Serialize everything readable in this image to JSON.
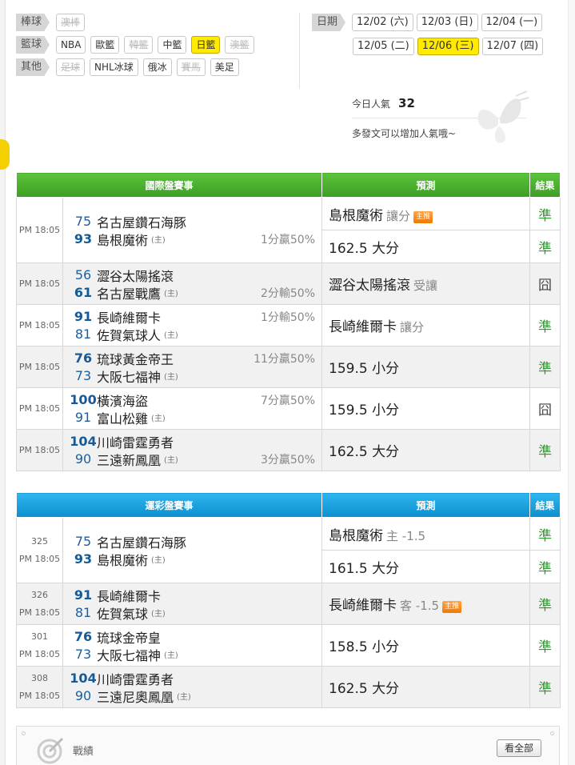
{
  "filters": [
    {
      "label": "棒球",
      "chips": [
        {
          "text": "澳棒",
          "state": "disabled"
        }
      ]
    },
    {
      "label": "籃球",
      "chips": [
        {
          "text": "NBA",
          "state": "normal"
        },
        {
          "text": "歐籃",
          "state": "normal"
        },
        {
          "text": "韓籃",
          "state": "disabled"
        },
        {
          "text": "中籃",
          "state": "normal"
        },
        {
          "text": "日籃",
          "state": "selected"
        },
        {
          "text": "澳籃",
          "state": "disabled"
        }
      ]
    },
    {
      "label": "其他",
      "chips": [
        {
          "text": "足球",
          "state": "disabled"
        },
        {
          "text": "NHL冰球",
          "state": "normal"
        },
        {
          "text": "俄冰",
          "state": "normal"
        },
        {
          "text": "賽馬",
          "state": "disabled"
        },
        {
          "text": "美足",
          "state": "normal"
        }
      ]
    }
  ],
  "dates": {
    "label": "日期",
    "rows": [
      [
        {
          "text": "12/02 (六)",
          "selected": false
        },
        {
          "text": "12/03 (日)",
          "selected": false
        },
        {
          "text": "12/04 (一)",
          "selected": false
        }
      ],
      [
        {
          "text": "12/05 (二)",
          "selected": false
        },
        {
          "text": "12/06 (三)",
          "selected": true
        },
        {
          "text": "12/07 (四)",
          "selected": false
        }
      ]
    ]
  },
  "popularity": {
    "label": "今日人氣",
    "value": "32",
    "hint": "多發文可以增加人氣哦~"
  },
  "international": {
    "headers": [
      "國際盤賽事",
      "預測",
      "結果"
    ],
    "home_mark": "(主)",
    "games": [
      {
        "time": "PM 18:05",
        "away": {
          "score": "75",
          "name": "名古屋鑽石海豚"
        },
        "home": {
          "score": "93",
          "name": "島根魔術"
        },
        "odds": "1分贏50%",
        "odds_line": 2,
        "picks": [
          {
            "text": "島根魔術",
            "sub": "讓分",
            "tag": "主推",
            "result": "準"
          },
          {
            "text": "162.5 大分",
            "sub": "",
            "tag": "",
            "result": "準"
          }
        ]
      },
      {
        "time": "PM 18:05",
        "away": {
          "score": "56",
          "name": "澀谷太陽搖滾"
        },
        "home": {
          "score": "61",
          "name": "名古屋戰鷹"
        },
        "odds": "2分輸50%",
        "odds_line": 2,
        "picks": [
          {
            "text": "澀谷太陽搖滾",
            "sub": "受讓",
            "tag": "",
            "result": "囧"
          }
        ]
      },
      {
        "time": "PM 18:05",
        "away": {
          "score": "91",
          "name": "長崎維爾卡"
        },
        "home": {
          "score": "81",
          "name": "佐賀氣球人"
        },
        "odds": "1分輸50%",
        "odds_line": 1,
        "picks": [
          {
            "text": "長崎維爾卡",
            "sub": "讓分",
            "tag": "",
            "result": "準"
          }
        ]
      },
      {
        "time": "PM 18:05",
        "away": {
          "score": "76",
          "name": "琉球黃金帝王"
        },
        "home": {
          "score": "73",
          "name": "大阪七福神"
        },
        "odds": "11分贏50%",
        "odds_line": 1,
        "picks": [
          {
            "text": "159.5 小分",
            "sub": "",
            "tag": "",
            "result": "準"
          }
        ]
      },
      {
        "time": "PM 18:05",
        "away": {
          "score": "100",
          "name": "橫濱海盜"
        },
        "home": {
          "score": "91",
          "name": "富山松雞"
        },
        "odds": "7分贏50%",
        "odds_line": 1,
        "picks": [
          {
            "text": "159.5 小分",
            "sub": "",
            "tag": "",
            "result": "囧"
          }
        ]
      },
      {
        "time": "PM 18:05",
        "away": {
          "score": "104",
          "name": "川崎雷霆勇者"
        },
        "home": {
          "score": "90",
          "name": "三遠新鳳凰"
        },
        "odds": "3分贏50%",
        "odds_line": 2,
        "picks": [
          {
            "text": "162.5 大分",
            "sub": "",
            "tag": "",
            "result": "準"
          }
        ]
      }
    ]
  },
  "sportslottery": {
    "headers": [
      "運彩盤賽事",
      "預測",
      "結果"
    ],
    "home_mark": "(主)",
    "games": [
      {
        "num": "325",
        "time": "PM 18:05",
        "away": {
          "score": "75",
          "name": "名古屋鑽石海豚"
        },
        "home": {
          "score": "93",
          "name": "島根魔術"
        },
        "picks": [
          {
            "text": "島根魔術",
            "sub": "主 -1.5",
            "tag": "",
            "result": "準"
          },
          {
            "text": "161.5 大分",
            "sub": "",
            "tag": "",
            "result": "準"
          }
        ]
      },
      {
        "num": "326",
        "time": "PM 18:05",
        "away": {
          "score": "91",
          "name": "長崎維爾卡"
        },
        "home": {
          "score": "81",
          "name": "佐賀氣球"
        },
        "picks": [
          {
            "text": "長崎維爾卡",
            "sub": "客 -1.5",
            "tag": "主推",
            "result": "準"
          }
        ]
      },
      {
        "num": "301",
        "time": "PM 18:05",
        "away": {
          "score": "76",
          "name": "琉球金帝皇"
        },
        "home": {
          "score": "73",
          "name": "大阪七福神"
        },
        "picks": [
          {
            "text": "158.5 小分",
            "sub": "",
            "tag": "",
            "result": "準"
          }
        ]
      },
      {
        "num": "308",
        "time": "PM 18:05",
        "away": {
          "score": "104",
          "name": "川崎雷霆勇者"
        },
        "home": {
          "score": "90",
          "name": "三遠尼奧鳳凰"
        },
        "picks": [
          {
            "text": "162.5 大分",
            "sub": "",
            "tag": "",
            "result": "準"
          }
        ]
      }
    ]
  },
  "record": {
    "label": "戰績",
    "view_all": "看全部"
  }
}
